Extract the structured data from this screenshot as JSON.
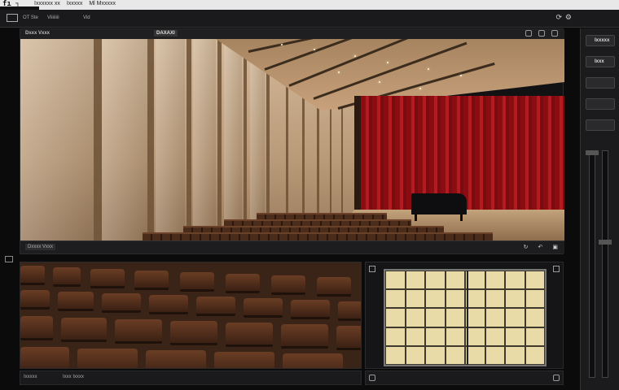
{
  "menubar": {
    "logo": "fı ┐",
    "tabs": [
      "Ixxxxxx xx",
      "Ixxxxx",
      "Ml Mxxxxx"
    ]
  },
  "toolbar": {
    "tabs": [
      "OT Ste",
      "Viiiiiiii",
      "Vid"
    ]
  },
  "viewer": {
    "title": "Dxxx Vxxx",
    "badge": "DAXAXI",
    "footer_label": "Dxxxx Vxxx"
  },
  "seats_panel": {
    "footer_left": "Ixxxxx",
    "footer_right": "Ixxx Ixxxx"
  },
  "sidebar": {
    "buttons": [
      "Ixxxxx",
      "Ixxx",
      "",
      "",
      ""
    ]
  },
  "colors": {
    "curtain": "#a8141a",
    "wall": "#c8ab8c",
    "seat": "#5a331f",
    "grid": "#e9dba8",
    "chrome": "#1a1a1c"
  }
}
